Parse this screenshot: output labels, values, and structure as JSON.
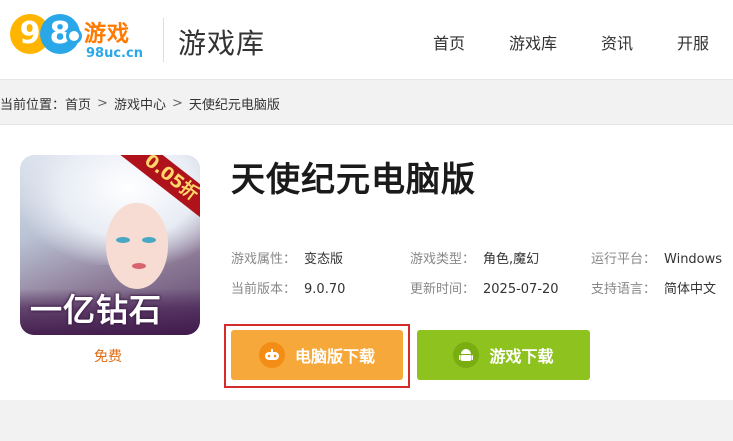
{
  "header": {
    "logo_brand": "游戏",
    "logo_domain": "98uc.cn",
    "section_title": "游戏库",
    "nav": [
      "首页",
      "游戏库",
      "资讯",
      "开服"
    ]
  },
  "breadcrumb": {
    "prefix": "当前位置：",
    "items": [
      "首页",
      "游戏中心",
      "天使纪元电脑版"
    ]
  },
  "game": {
    "title": "天使纪元电脑版",
    "price": "免费",
    "icon_badge": "0.05折",
    "icon_banner": "一亿钻石",
    "meta": [
      {
        "label": "游戏属性：",
        "value": "变态版"
      },
      {
        "label": "游戏类型：",
        "value": "角色,魔幻"
      },
      {
        "label": "运行平台：",
        "value": "Windows"
      },
      {
        "label": "当前版本：",
        "value": "9.0.70"
      },
      {
        "label": "更新时间：",
        "value": "2025-07-20"
      },
      {
        "label": "支持语言：",
        "value": "简体中文"
      }
    ]
  },
  "actions": {
    "pc_download": "电脑版下载",
    "game_download": "游戏下载"
  },
  "colors": {
    "pc_button": "#f7a83a",
    "game_button": "#8dc21f",
    "highlight": "#d62b2b",
    "price": "#e06b13"
  }
}
